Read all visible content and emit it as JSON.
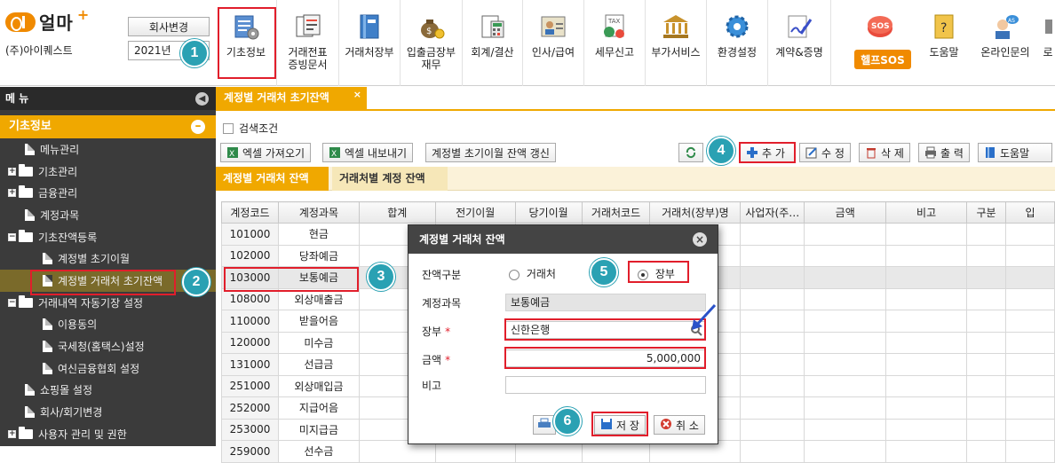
{
  "brand": {
    "logo": "얼마",
    "plus": "+",
    "company": "(주)아이퀘스트",
    "change_company": "회사변경",
    "year": "2021년"
  },
  "menu": [
    {
      "label": "기초정보"
    },
    {
      "label": "거래전표\n증빙문서"
    },
    {
      "label": "거래처장부"
    },
    {
      "label": "입출금장부\n재무"
    },
    {
      "label": "회계/결산"
    },
    {
      "label": "인사/급여"
    },
    {
      "label": "세무신고"
    },
    {
      "label": "부가서비스"
    },
    {
      "label": "환경설정"
    },
    {
      "label": "계약&증명"
    },
    {
      "label": "헬프SOS"
    },
    {
      "label": "도움말"
    },
    {
      "label": "온라인문의"
    },
    {
      "label": "로"
    }
  ],
  "sidebar": {
    "title": "메 뉴",
    "section": "기초정보",
    "items": [
      {
        "label": "메뉴관리"
      },
      {
        "label": "기초관리"
      },
      {
        "label": "금융관리"
      },
      {
        "label": "계정과목"
      },
      {
        "label": "기초잔액등록"
      },
      {
        "label": "계정별 초기이월"
      },
      {
        "label": "계정별 거래처 초기잔액"
      },
      {
        "label": "거래내역 자동기장 설정"
      },
      {
        "label": "이용동의"
      },
      {
        "label": "국세청(홈택스)설정"
      },
      {
        "label": "여신금융협회 설정"
      },
      {
        "label": "쇼핑몰 설정"
      },
      {
        "label": "회사/회기변경"
      },
      {
        "label": "사용자 관리 및 권한"
      }
    ]
  },
  "tab": {
    "label": "계정별 거래처 초기잔액",
    "close": "×"
  },
  "search": {
    "label": "검색조건"
  },
  "toolbar": {
    "excel_import": "엑셀 가져오기",
    "excel_export": "엑셀 내보내기",
    "refresh_balance": "계정별 초기이월 잔액 갱신",
    "add": "추 가",
    "edit": "수 정",
    "delete": "삭 제",
    "print": "출 력",
    "help": "도움말"
  },
  "subtabs": {
    "by_account": "계정별 거래처 잔액",
    "by_partner": "거래처별 계정 잔액"
  },
  "grid": {
    "headers": [
      "계정코드",
      "계정과목",
      "합계",
      "전기이월",
      "당기이월",
      "거래처코드",
      "거래처(장부)명",
      "사업자(주…",
      "금액",
      "비고",
      "구분",
      "입"
    ],
    "rows": [
      {
        "code": "101000",
        "name": "현금",
        "total": ""
      },
      {
        "code": "102000",
        "name": "당좌예금",
        "total": ""
      },
      {
        "code": "103000",
        "name": "보통예금",
        "total": ""
      },
      {
        "code": "108000",
        "name": "외상매출금",
        "total": "3,0"
      },
      {
        "code": "110000",
        "name": "받을어음",
        "total": ""
      },
      {
        "code": "120000",
        "name": "미수금",
        "total": ""
      },
      {
        "code": "131000",
        "name": "선급금",
        "total": ""
      },
      {
        "code": "251000",
        "name": "외상매입금",
        "total": ""
      },
      {
        "code": "252000",
        "name": "지급어음",
        "total": ""
      },
      {
        "code": "253000",
        "name": "미지급금",
        "total": ""
      },
      {
        "code": "259000",
        "name": "선수금",
        "total": ""
      }
    ]
  },
  "dialog": {
    "title": "계정별 거래처 잔액",
    "balance_type_label": "잔액구분",
    "opt_partner": "거래처",
    "opt_ledger": "장부",
    "account_label": "계정과목",
    "account_value": "보통예금",
    "ledger_label": "장부",
    "ledger_value": "신한은행",
    "amount_label": "금액",
    "amount_value": "5,000,000",
    "note_label": "비고",
    "note_value": "",
    "save": "저 장",
    "cancel": "취 소"
  },
  "steps": [
    "1",
    "2",
    "3",
    "4",
    "5",
    "6"
  ],
  "colors": {
    "accent": "#f0a800",
    "highlight": "#e11e2b",
    "badge": "#2aa1b3",
    "sidebar": "#3b3b3b"
  }
}
